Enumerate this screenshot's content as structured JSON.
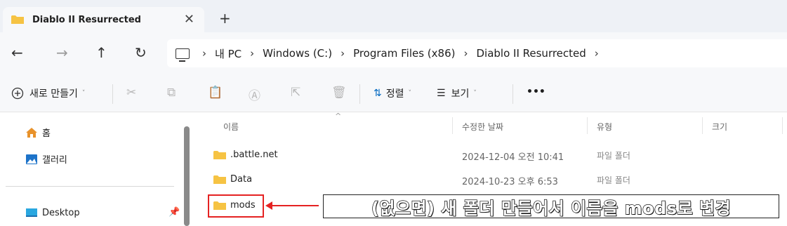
{
  "tab": {
    "title": "Diablo II Resurrected",
    "close": "✕",
    "new": "+"
  },
  "nav": {
    "back": "←",
    "forward": "→",
    "up": "↑",
    "refresh": "↻"
  },
  "breadcrumb": {
    "sep": "›",
    "items": [
      "내 PC",
      "Windows (C:)",
      "Program Files (x86)",
      "Diablo II Resurrected"
    ]
  },
  "toolbar": {
    "new_label": "새로 만들기",
    "sort_label": "정렬",
    "view_label": "보기",
    "more": "•••",
    "caret": "˅",
    "icons": [
      "cut-icon",
      "copy-icon",
      "paste-icon",
      "rename-icon",
      "share-icon",
      "delete-icon"
    ]
  },
  "sidebar": {
    "items": [
      {
        "label": "홈",
        "icon": "home-icon"
      },
      {
        "label": "갤러리",
        "icon": "gallery-icon"
      },
      {
        "label": "Desktop",
        "icon": "desktop-icon"
      }
    ]
  },
  "columns": {
    "name": "이름",
    "modified": "수정한 날짜",
    "type": "유형",
    "size": "크기"
  },
  "files": [
    {
      "name": ".battle.net",
      "date": "2024-12-04 오전 10:41",
      "type": "파일 폴더"
    },
    {
      "name": "Data",
      "date": "2024-10-23 오후 6:53",
      "type": "파일 폴더"
    },
    {
      "name": "mods",
      "date": "",
      "type": ""
    }
  ],
  "annotation": {
    "text": "(없으면) 새 폴더 만들어서 이름을 mods로 변경"
  },
  "colors": {
    "folder": "#f6c343",
    "highlight": "#e52222",
    "accent": "#0067c0"
  }
}
